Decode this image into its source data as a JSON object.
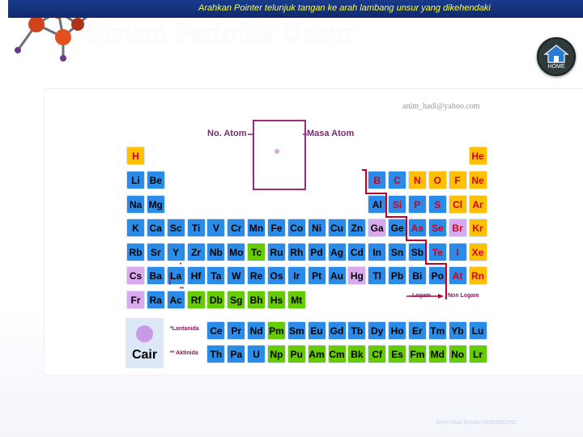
{
  "header": {
    "instruction": "Arahkan Pointer telunjuk tangan ke arah lambang unsur yang dikehendaki",
    "title": "Sistem Periodik Unsur",
    "home_label": "HOME"
  },
  "panel": {
    "email": "anim_hadi@yahoo.com",
    "key_labels": {
      "atomic_number": "No. Atom",
      "atomic_mass": "Masa Atom"
    },
    "series_labels": {
      "lanthanides": "*Lantanida",
      "actinides": "** Aktinida"
    },
    "type_labels": {
      "metal": "Logam",
      "nonmetal": "Non Logam"
    },
    "legend": {
      "label": "Cair"
    }
  },
  "footer": {
    "credit": "Anim Hadi Bisrata 08663952092"
  },
  "colors": {
    "header_bar": "#1a3a8c",
    "header_text": "#ffff33",
    "blue_cell": "#2a8ce8",
    "yellow_cell": "#ffc000",
    "green_cell": "#66cc00",
    "lilac_cell": "#d9a8ef",
    "red_text": "#d00020",
    "border_line": "#c0002a"
  },
  "elements": [
    {
      "symbol": "H",
      "row": 0,
      "col": 0,
      "kind": "orange"
    },
    {
      "symbol": "He",
      "row": 0,
      "col": 17,
      "kind": "orange"
    },
    {
      "symbol": "Li",
      "row": 1,
      "col": 0,
      "kind": "blue"
    },
    {
      "symbol": "Be",
      "row": 1,
      "col": 1,
      "kind": "blue"
    },
    {
      "symbol": "B",
      "row": 1,
      "col": 12,
      "kind": "blue-red"
    },
    {
      "symbol": "C",
      "row": 1,
      "col": 13,
      "kind": "blue-red"
    },
    {
      "symbol": "N",
      "row": 1,
      "col": 14,
      "kind": "orange"
    },
    {
      "symbol": "O",
      "row": 1,
      "col": 15,
      "kind": "orange"
    },
    {
      "symbol": "F",
      "row": 1,
      "col": 16,
      "kind": "orange"
    },
    {
      "symbol": "Ne",
      "row": 1,
      "col": 17,
      "kind": "orange"
    },
    {
      "symbol": "Na",
      "row": 2,
      "col": 0,
      "kind": "blue"
    },
    {
      "symbol": "Mg",
      "row": 2,
      "col": 1,
      "kind": "blue"
    },
    {
      "symbol": "Al",
      "row": 2,
      "col": 12,
      "kind": "blue"
    },
    {
      "symbol": "Si",
      "row": 2,
      "col": 13,
      "kind": "blue-red"
    },
    {
      "symbol": "P",
      "row": 2,
      "col": 14,
      "kind": "blue-red"
    },
    {
      "symbol": "S",
      "row": 2,
      "col": 15,
      "kind": "blue-red"
    },
    {
      "symbol": "Cl",
      "row": 2,
      "col": 16,
      "kind": "orange"
    },
    {
      "symbol": "Ar",
      "row": 2,
      "col": 17,
      "kind": "orange"
    },
    {
      "symbol": "K",
      "row": 3,
      "col": 0,
      "kind": "blue"
    },
    {
      "symbol": "Ca",
      "row": 3,
      "col": 1,
      "kind": "blue"
    },
    {
      "symbol": "Sc",
      "row": 3,
      "col": 2,
      "kind": "blue"
    },
    {
      "symbol": "Ti",
      "row": 3,
      "col": 3,
      "kind": "blue"
    },
    {
      "symbol": "V",
      "row": 3,
      "col": 4,
      "kind": "blue"
    },
    {
      "symbol": "Cr",
      "row": 3,
      "col": 5,
      "kind": "blue"
    },
    {
      "symbol": "Mn",
      "row": 3,
      "col": 6,
      "kind": "blue"
    },
    {
      "symbol": "Fe",
      "row": 3,
      "col": 7,
      "kind": "blue"
    },
    {
      "symbol": "Co",
      "row": 3,
      "col": 8,
      "kind": "blue"
    },
    {
      "symbol": "Ni",
      "row": 3,
      "col": 9,
      "kind": "blue"
    },
    {
      "symbol": "Cu",
      "row": 3,
      "col": 10,
      "kind": "blue"
    },
    {
      "symbol": "Zn",
      "row": 3,
      "col": 11,
      "kind": "blue"
    },
    {
      "symbol": "Ga",
      "row": 3,
      "col": 12,
      "kind": "lilac"
    },
    {
      "symbol": "Ge",
      "row": 3,
      "col": 13,
      "kind": "blue"
    },
    {
      "symbol": "As",
      "row": 3,
      "col": 14,
      "kind": "blue-red"
    },
    {
      "symbol": "Se",
      "row": 3,
      "col": 15,
      "kind": "blue-red"
    },
    {
      "symbol": "Br",
      "row": 3,
      "col": 16,
      "kind": "lilac-red"
    },
    {
      "symbol": "Kr",
      "row": 3,
      "col": 17,
      "kind": "orange"
    },
    {
      "symbol": "Rb",
      "row": 4,
      "col": 0,
      "kind": "blue"
    },
    {
      "symbol": "Sr",
      "row": 4,
      "col": 1,
      "kind": "blue"
    },
    {
      "symbol": "Y",
      "row": 4,
      "col": 2,
      "kind": "blue"
    },
    {
      "symbol": "Zr",
      "row": 4,
      "col": 3,
      "kind": "blue"
    },
    {
      "symbol": "Nb",
      "row": 4,
      "col": 4,
      "kind": "blue"
    },
    {
      "symbol": "Mo",
      "row": 4,
      "col": 5,
      "kind": "blue"
    },
    {
      "symbol": "Tc",
      "row": 4,
      "col": 6,
      "kind": "green"
    },
    {
      "symbol": "Ru",
      "row": 4,
      "col": 7,
      "kind": "blue"
    },
    {
      "symbol": "Rh",
      "row": 4,
      "col": 8,
      "kind": "blue"
    },
    {
      "symbol": "Pd",
      "row": 4,
      "col": 9,
      "kind": "blue"
    },
    {
      "symbol": "Ag",
      "row": 4,
      "col": 10,
      "kind": "blue"
    },
    {
      "symbol": "Cd",
      "row": 4,
      "col": 11,
      "kind": "blue"
    },
    {
      "symbol": "In",
      "row": 4,
      "col": 12,
      "kind": "blue"
    },
    {
      "symbol": "Sn",
      "row": 4,
      "col": 13,
      "kind": "blue"
    },
    {
      "symbol": "Sb",
      "row": 4,
      "col": 14,
      "kind": "blue"
    },
    {
      "symbol": "Te",
      "row": 4,
      "col": 15,
      "kind": "blue-red"
    },
    {
      "symbol": "I",
      "row": 4,
      "col": 16,
      "kind": "blue-red"
    },
    {
      "symbol": "Xe",
      "row": 4,
      "col": 17,
      "kind": "orange"
    },
    {
      "symbol": "Cs",
      "row": 5,
      "col": 0,
      "kind": "lilac"
    },
    {
      "symbol": "Ba",
      "row": 5,
      "col": 1,
      "kind": "blue"
    },
    {
      "symbol": "La",
      "row": 5,
      "col": 2,
      "kind": "blue",
      "mark": "*"
    },
    {
      "symbol": "Hf",
      "row": 5,
      "col": 3,
      "kind": "blue"
    },
    {
      "symbol": "Ta",
      "row": 5,
      "col": 4,
      "kind": "blue"
    },
    {
      "symbol": "W",
      "row": 5,
      "col": 5,
      "kind": "blue"
    },
    {
      "symbol": "Re",
      "row": 5,
      "col": 6,
      "kind": "blue"
    },
    {
      "symbol": "Os",
      "row": 5,
      "col": 7,
      "kind": "blue"
    },
    {
      "symbol": "Ir",
      "row": 5,
      "col": 8,
      "kind": "blue"
    },
    {
      "symbol": "Pt",
      "row": 5,
      "col": 9,
      "kind": "blue"
    },
    {
      "symbol": "Au",
      "row": 5,
      "col": 10,
      "kind": "blue"
    },
    {
      "symbol": "Hg",
      "row": 5,
      "col": 11,
      "kind": "lilac"
    },
    {
      "symbol": "Tl",
      "row": 5,
      "col": 12,
      "kind": "blue"
    },
    {
      "symbol": "Pb",
      "row": 5,
      "col": 13,
      "kind": "blue"
    },
    {
      "symbol": "Bi",
      "row": 5,
      "col": 14,
      "kind": "blue"
    },
    {
      "symbol": "Po",
      "row": 5,
      "col": 15,
      "kind": "blue"
    },
    {
      "symbol": "At",
      "row": 5,
      "col": 16,
      "kind": "blue-red"
    },
    {
      "symbol": "Rn",
      "row": 5,
      "col": 17,
      "kind": "orange"
    },
    {
      "symbol": "Fr",
      "row": 6,
      "col": 0,
      "kind": "lilac"
    },
    {
      "symbol": "Ra",
      "row": 6,
      "col": 1,
      "kind": "blue"
    },
    {
      "symbol": "Ac",
      "row": 6,
      "col": 2,
      "kind": "blue",
      "mark": "**"
    },
    {
      "symbol": "Rf",
      "row": 6,
      "col": 3,
      "kind": "green"
    },
    {
      "symbol": "Db",
      "row": 6,
      "col": 4,
      "kind": "green"
    },
    {
      "symbol": "Sg",
      "row": 6,
      "col": 5,
      "kind": "green"
    },
    {
      "symbol": "Bh",
      "row": 6,
      "col": 6,
      "kind": "green"
    },
    {
      "symbol": "Hs",
      "row": 6,
      "col": 7,
      "kind": "green"
    },
    {
      "symbol": "Mt",
      "row": 6,
      "col": 8,
      "kind": "green"
    },
    {
      "symbol": "Ce",
      "row": 7,
      "col": 4,
      "kind": "blue"
    },
    {
      "symbol": "Pr",
      "row": 7,
      "col": 5,
      "kind": "blue"
    },
    {
      "symbol": "Nd",
      "row": 7,
      "col": 6,
      "kind": "blue"
    },
    {
      "symbol": "Pm",
      "row": 7,
      "col": 7,
      "kind": "green"
    },
    {
      "symbol": "Sm",
      "row": 7,
      "col": 8,
      "kind": "blue"
    },
    {
      "symbol": "Eu",
      "row": 7,
      "col": 9,
      "kind": "blue"
    },
    {
      "symbol": "Gd",
      "row": 7,
      "col": 10,
      "kind": "blue"
    },
    {
      "symbol": "Tb",
      "row": 7,
      "col": 11,
      "kind": "blue"
    },
    {
      "symbol": "Dy",
      "row": 7,
      "col": 12,
      "kind": "blue"
    },
    {
      "symbol": "Ho",
      "row": 7,
      "col": 13,
      "kind": "blue"
    },
    {
      "symbol": "Er",
      "row": 7,
      "col": 14,
      "kind": "blue"
    },
    {
      "symbol": "Tm",
      "row": 7,
      "col": 15,
      "kind": "blue"
    },
    {
      "symbol": "Yb",
      "row": 7,
      "col": 16,
      "kind": "blue"
    },
    {
      "symbol": "Lu",
      "row": 7,
      "col": 17,
      "kind": "blue"
    },
    {
      "symbol": "Th",
      "row": 8,
      "col": 4,
      "kind": "blue"
    },
    {
      "symbol": "Pa",
      "row": 8,
      "col": 5,
      "kind": "blue"
    },
    {
      "symbol": "U",
      "row": 8,
      "col": 6,
      "kind": "blue"
    },
    {
      "symbol": "Np",
      "row": 8,
      "col": 7,
      "kind": "green"
    },
    {
      "symbol": "Pu",
      "row": 8,
      "col": 8,
      "kind": "green"
    },
    {
      "symbol": "Am",
      "row": 8,
      "col": 9,
      "kind": "green"
    },
    {
      "symbol": "Cm",
      "row": 8,
      "col": 10,
      "kind": "green"
    },
    {
      "symbol": "Bk",
      "row": 8,
      "col": 11,
      "kind": "green"
    },
    {
      "symbol": "Cf",
      "row": 8,
      "col": 12,
      "kind": "green"
    },
    {
      "symbol": "Es",
      "row": 8,
      "col": 13,
      "kind": "green"
    },
    {
      "symbol": "Fm",
      "row": 8,
      "col": 14,
      "kind": "green"
    },
    {
      "symbol": "Md",
      "row": 8,
      "col": 15,
      "kind": "green"
    },
    {
      "symbol": "No",
      "row": 8,
      "col": 16,
      "kind": "green"
    },
    {
      "symbol": "Lr",
      "row": 8,
      "col": 17,
      "kind": "green"
    }
  ]
}
